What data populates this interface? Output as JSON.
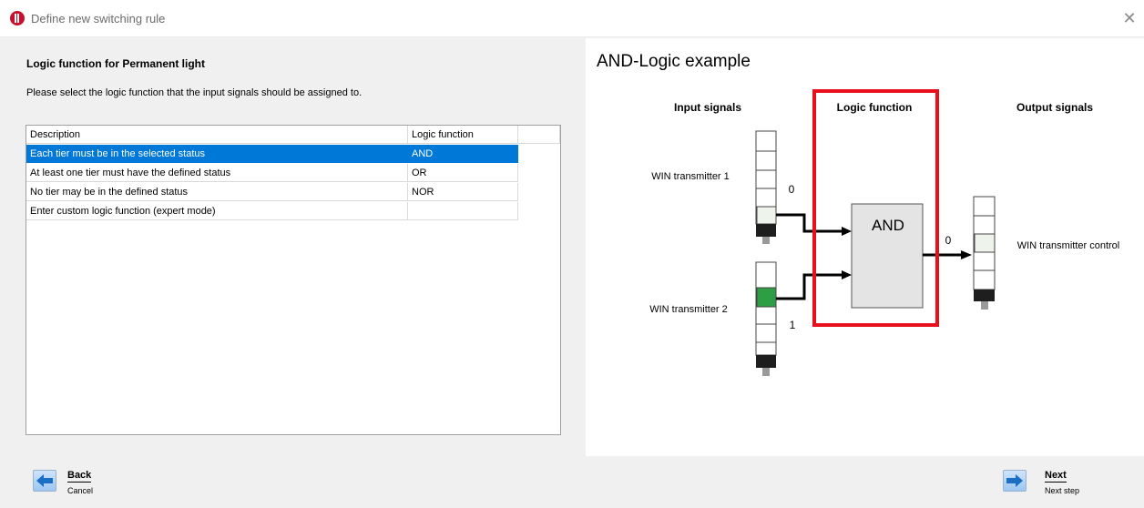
{
  "window": {
    "title": "Define new switching rule",
    "close_symbol": "✕"
  },
  "left": {
    "heading": "Logic function for Permanent light",
    "instructions": "Please select the logic function that the input signals should be assigned to.",
    "table": {
      "columns": [
        "Description",
        "Logic function"
      ],
      "rows": [
        {
          "description": "Each tier must be in the selected status",
          "function": "AND",
          "selected": true
        },
        {
          "description": "At least one tier must have the defined status",
          "function": "OR",
          "selected": false
        },
        {
          "description": "No tier may be in the defined status",
          "function": "NOR",
          "selected": false
        },
        {
          "description": "Enter custom logic function (expert mode)",
          "function": "",
          "selected": false
        }
      ]
    }
  },
  "right": {
    "title": "AND-Logic example",
    "input_header": "Input signals",
    "logic_header": "Logic function",
    "output_header": "Output signals",
    "input1_label": "WIN transmitter 1",
    "input1_value": "0",
    "input2_label": "WIN transmitter 2",
    "input2_value": "1",
    "gate_label": "AND",
    "output_value": "0",
    "output_label": "WIN transmitter control",
    "colors": {
      "highlight_box": "#e8101c",
      "lit_green": "#2e9e44",
      "off_light": "#eef3ec",
      "gate_fill": "#e4e4e4"
    }
  },
  "footer": {
    "back_label": "Back",
    "back_sub": "Cancel",
    "next_label": "Next",
    "next_sub": "Next step",
    "icons": {
      "back": "arrow-left-icon",
      "next": "arrow-right-icon"
    }
  }
}
